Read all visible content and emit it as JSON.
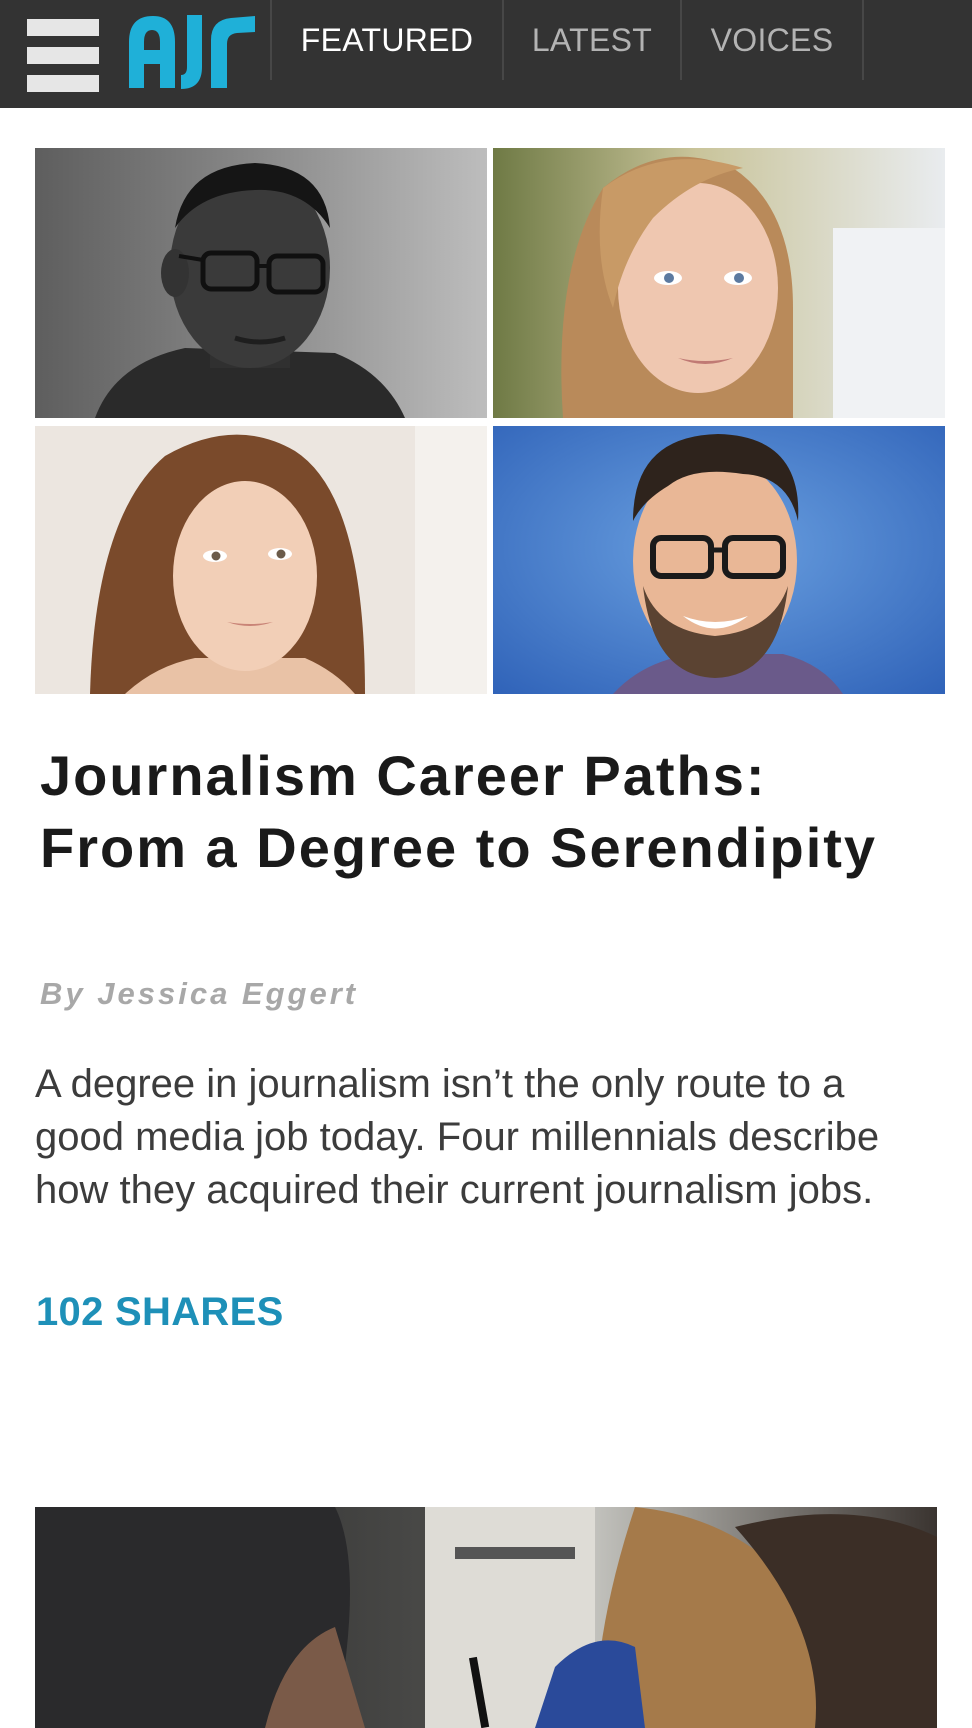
{
  "brand": {
    "logo_text": "AJR",
    "logo_color": "#1fb0d8"
  },
  "topbar": {
    "background": "#333333",
    "menu_icon": "hamburger-menu-icon"
  },
  "nav": {
    "items": [
      {
        "label": "FEATURED",
        "active": true
      },
      {
        "label": "LATEST",
        "active": false
      },
      {
        "label": "VOICES",
        "active": false
      }
    ]
  },
  "article": {
    "headline": "Journalism Career Paths: From a Degree to Serendipity",
    "byline_prefix": "By",
    "author": "Jessica Eggert",
    "summary": "A degree in journalism isn’t the only route to a good media job today. Four millennials describe how they acquired their current journalism jobs.",
    "shares": "102 SHARES",
    "accent_color": "#1e90b8"
  }
}
